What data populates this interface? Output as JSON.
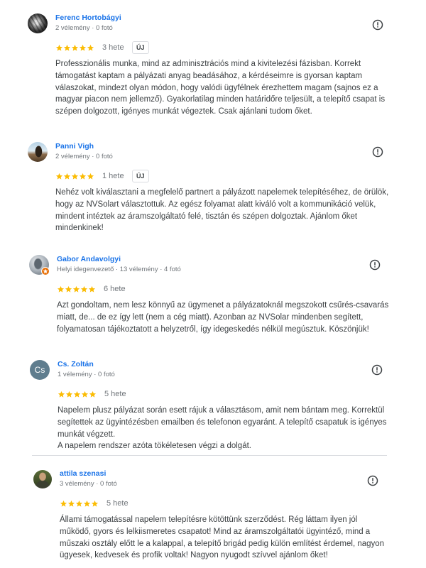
{
  "reviews": [
    {
      "author": "Ferenc Hortobágyi",
      "meta": "2 vélemény · 0 fotó",
      "rating": 5,
      "time": "3 hete",
      "badge": "ÚJ",
      "text_lines": [
        "Professzionális munka, mind az adminisztrációs mind a kivitelezési fázisban. Korrekt",
        "támogatást kaptam a pályázati anyag beadásához, a kérdéseimre is gyorsan kaptam",
        "válaszokat, mindezt olyan módon, hogy valódi ügyfélnek érezhettem magam (sajnos ez a",
        "magyar piacon nem jellemző). Gyakorlatilag minden határidőre teljesült, a telepítő csapat is",
        "szépen dolgozott, igényes munkát végeztek. Csak ajánlani tudom őket."
      ]
    },
    {
      "author": "Panni Vigh",
      "meta": "2 vélemény · 0 fotó",
      "rating": 5,
      "time": "1 hete",
      "badge": "ÚJ",
      "text_lines": [
        "Nehéz volt kiválasztani a megfelelő partnert a pályázott napelemek telepítéséhez, de örülök,",
        "hogy az NVSolart választottuk. Az egész folyamat alatt kiváló volt a kommunikáció velük,",
        "mindent intéztek az áramszolgáltató felé, tisztán és szépen dolgoztak. Ajánlom őket",
        "mindenkinek!"
      ]
    },
    {
      "author": "Gabor Andavolgyi",
      "meta": "Helyi idegenvezető · 13 vélemény · 4 fotó",
      "rating": 5,
      "time": "6 hete",
      "text_lines": [
        "Azt gondoltam, nem lesz könnyű az ügymenet a pályázatoknál megszokott csűrés-csavarás",
        "miatt, de... de ez így lett (nem a cég miatt). Azonban az NVSolar mindenben segített,",
        "folyamatosan tájékoztatott a helyzetről, így idegeskedés nélkül megúsztuk. Köszönjük!"
      ]
    },
    {
      "author": "Cs. Zoltán",
      "avatar_initials": "Cs",
      "meta": "1 vélemény · 0 fotó",
      "rating": 5,
      "time": "5 hete",
      "text_lines": [
        "Napelem plusz pályázat során esett rájuk a választásom, amit nem bántam meg. Korrektül",
        "segítettek az ügyintézésben emailben és telefonon egyaránt. A telepítő csapatuk is igényes",
        "munkát végzett.",
        "A napelem rendszer azóta tökéletesen végzi a dolgát."
      ]
    },
    {
      "author": "attila szenasi",
      "meta": "3 vélemény · 0 fotó",
      "rating": 5,
      "time": "5 hete",
      "text_lines": [
        "Állami támogatással napelem telepítésre kötöttünk szerződést. Rég láttam ilyen jól",
        "működő, gyors és lelkiismeretes csapatot! Mind az áramszolgáltatói ügyintéző, mind a",
        "műszaki osztály előtt le a kalappal, a telepítő brigád pedig külön említést érdemel, nagyon",
        "ügyesek, kedvesek és profik voltak! Nagyon nyugodt szívvel ajánlom őket!"
      ]
    }
  ],
  "icons": {
    "report": "report-icon",
    "star": "star-icon",
    "local_guide": "local-guide-badge-icon"
  },
  "colors": {
    "link": "#1a73e8",
    "meta": "#70757a",
    "text": "#3c4043",
    "star": "#fbbc04",
    "star_empty": "#dadce0",
    "local_guide": "#e8710a",
    "initials_avatar": "#5f7d8e"
  }
}
